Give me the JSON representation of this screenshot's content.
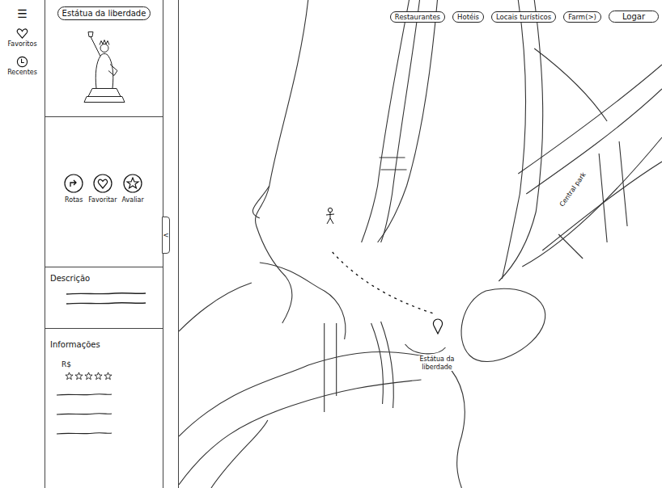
{
  "menu_icon": "☰",
  "rail": [
    {
      "label": "Favoritos"
    },
    {
      "label": "Recentes"
    }
  ],
  "place": {
    "title": "Estátua da liberdade",
    "actions": [
      {
        "label": "Rotas"
      },
      {
        "label": "Favoritar"
      },
      {
        "label": "Avaliar"
      }
    ],
    "description": {
      "heading": "Descrição"
    },
    "info": {
      "heading": "Informações",
      "price": "R$",
      "stars": 0
    }
  },
  "collapse_icon": "<",
  "toolbar": [
    {
      "label": "Restaurantes"
    },
    {
      "label": "Hotéis"
    },
    {
      "label": "Locais turísticos"
    },
    {
      "label": "Farm(>)"
    }
  ],
  "login": "Logar",
  "map": {
    "labels": [
      {
        "text": "Central park"
      }
    ],
    "destination": {
      "label": "Estátua da liberdade"
    }
  }
}
